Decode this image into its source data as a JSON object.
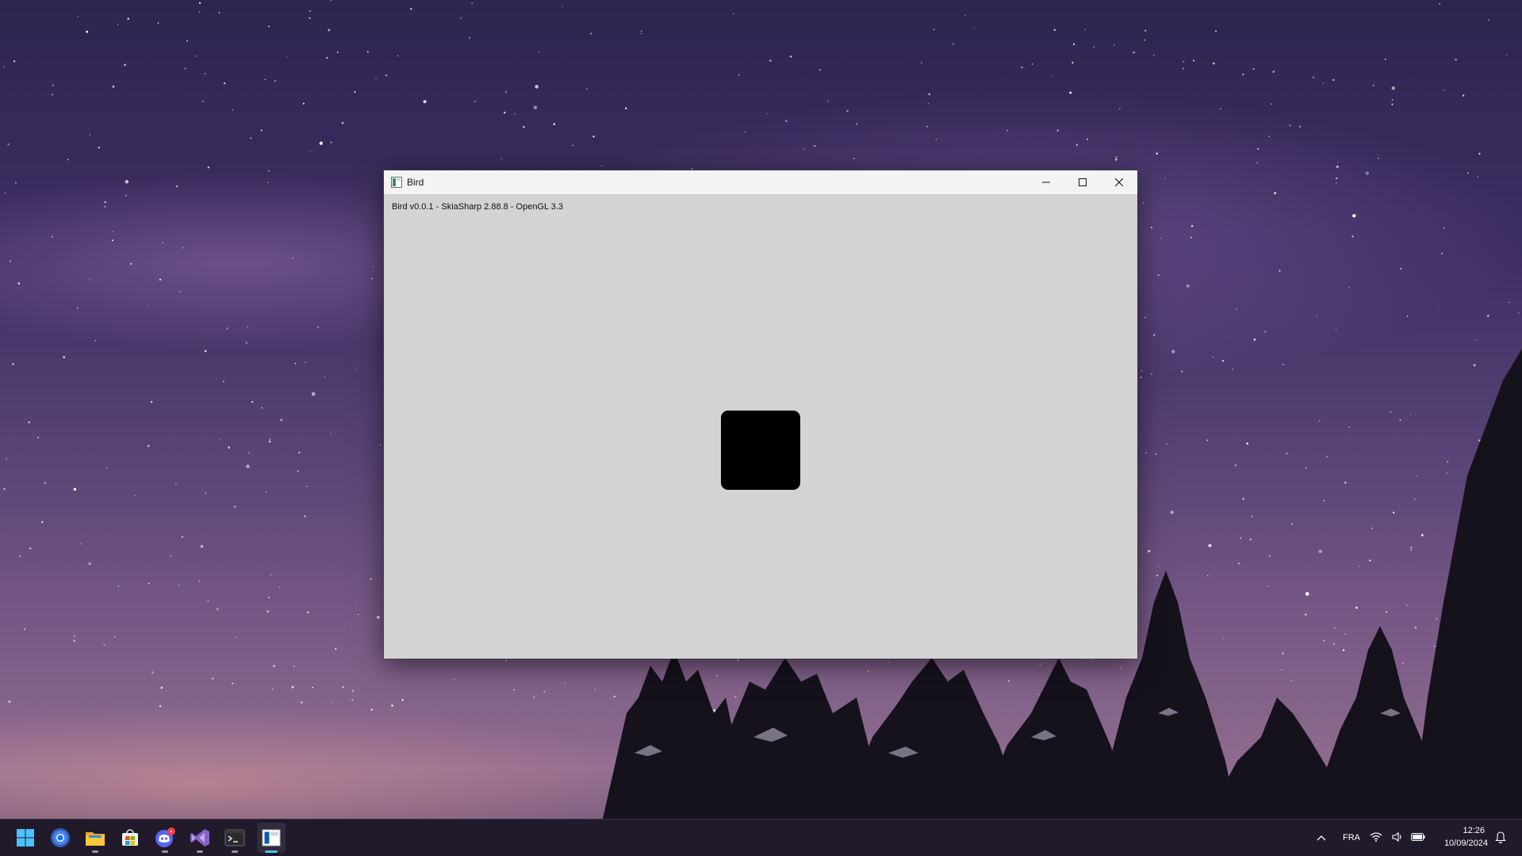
{
  "window": {
    "title": "Bird",
    "status_text": "Bird v0.0.1 - SkiaSharp 2.88.8 - OpenGL 3.3",
    "client_bg": "#d3d3d3",
    "bird_color": "#000000"
  },
  "taskbar": {
    "apps": [
      {
        "name": "start-button",
        "icon": "windows-logo-icon"
      },
      {
        "name": "chrome",
        "icon": "chrome-icon"
      },
      {
        "name": "file-explorer",
        "icon": "folder-icon"
      },
      {
        "name": "microsoft-store",
        "icon": "store-icon"
      },
      {
        "name": "discord",
        "icon": "discord-icon"
      },
      {
        "name": "visual-studio",
        "icon": "visual-studio-icon"
      },
      {
        "name": "terminal",
        "icon": "terminal-icon"
      },
      {
        "name": "bird-app",
        "icon": "app-window-icon"
      }
    ],
    "tray": {
      "language": "FRA",
      "time": "12:26",
      "date": "10/09/2024"
    }
  }
}
